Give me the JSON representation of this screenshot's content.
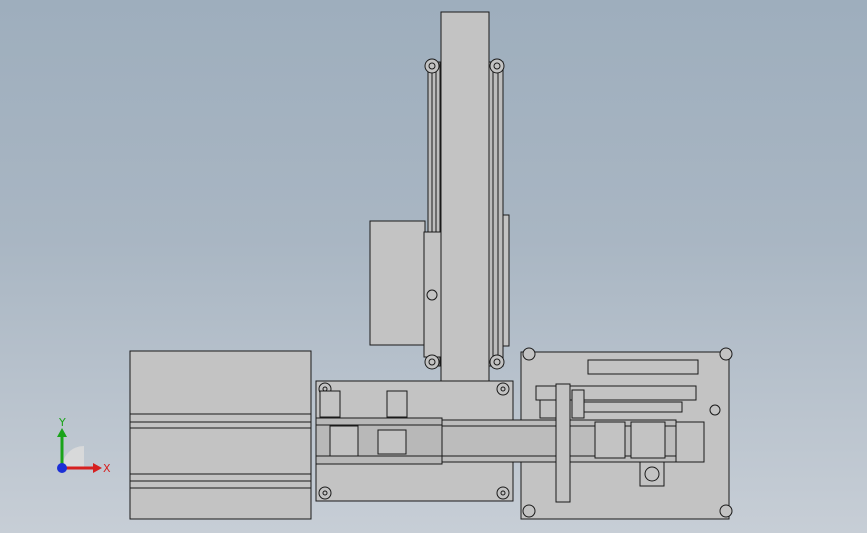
{
  "viewport": {
    "background_top": "#9eaebd",
    "background_bottom": "#c7ced6",
    "model_fill": "#c3c3c3",
    "model_edge": "#1a1a1a"
  },
  "triad": {
    "x_label": "X",
    "y_label": "Y",
    "x_color": "#d62020",
    "y_color": "#1aa31a",
    "z_color": "#1b2fd6"
  }
}
